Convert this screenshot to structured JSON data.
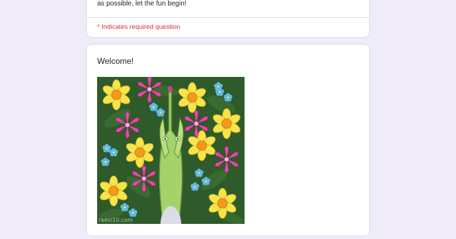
{
  "top_card": {
    "description_tail": "as possible, let the fun begin!",
    "required_note": "* Indicates required question"
  },
  "section": {
    "title": "Welcome!",
    "image": {
      "watermark": "raevi10.com"
    }
  },
  "colors": {
    "page_background": "#f0ebf8",
    "required_red": "#d93025",
    "art_background": "#2f5a2a"
  }
}
